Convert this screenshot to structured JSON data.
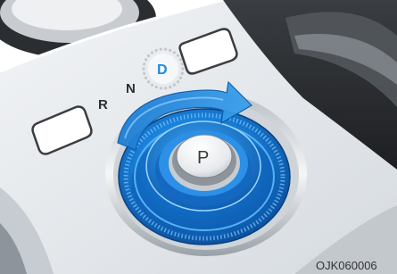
{
  "gear_selector": {
    "positions": [
      {
        "label": "R",
        "selected": false
      },
      {
        "label": "N",
        "selected": false
      },
      {
        "label": "D",
        "selected": true
      }
    ],
    "park_button_label": "P",
    "rotation_direction": "clockwise"
  },
  "figure_code": "OJK060006",
  "colors": {
    "dial_blue": "#1a7fd6",
    "dial_blue_dark": "#0a4f9e",
    "arrow_blue": "#2a8ee0",
    "selected_label": "#1f8be0",
    "dotted_ring": "#c2c8ce",
    "label_text": "#2e2e2e"
  }
}
